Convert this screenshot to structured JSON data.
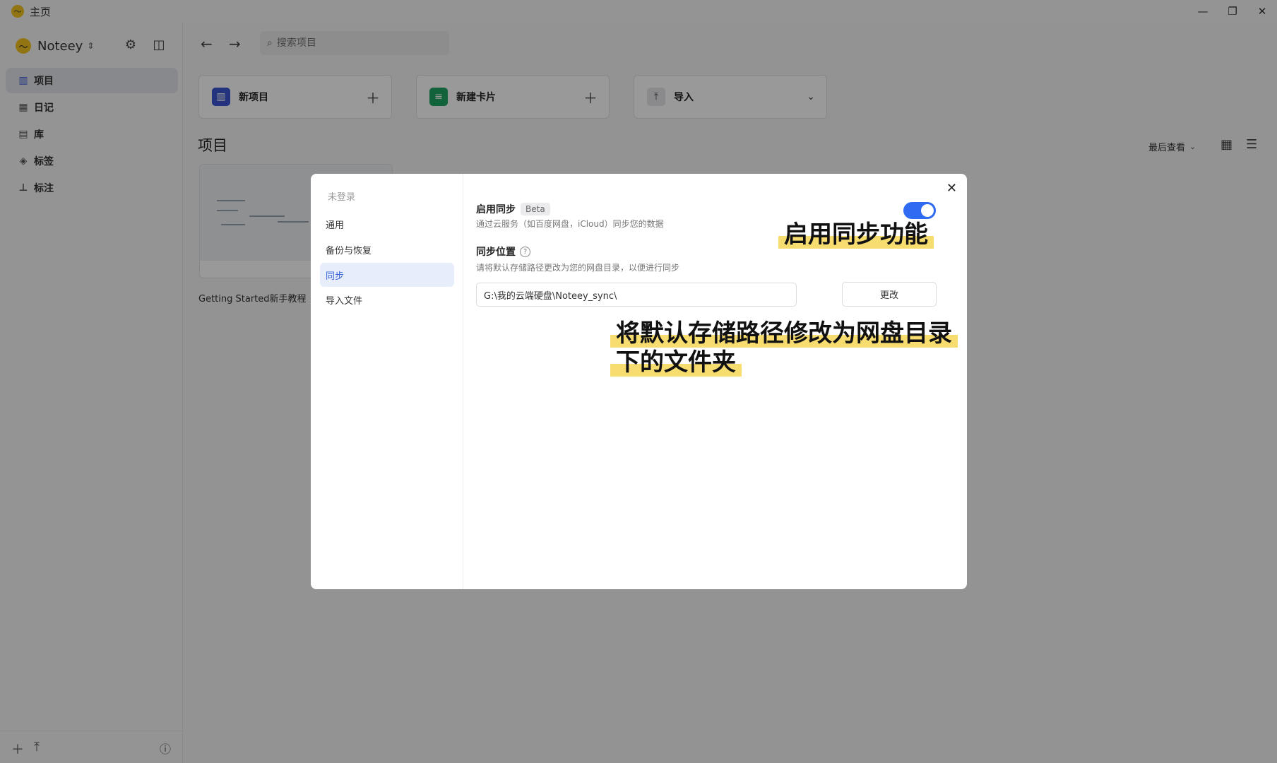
{
  "window": {
    "title": "主页",
    "controls": [
      "—",
      "❐",
      "✕"
    ]
  },
  "sidebar": {
    "workspace_name": "Noteey",
    "items": [
      {
        "label": "项目",
        "icon": "map-icon",
        "active": true
      },
      {
        "label": "日记",
        "icon": "calendar-icon",
        "active": false
      },
      {
        "label": "库",
        "icon": "library-icon",
        "active": false
      },
      {
        "label": "标签",
        "icon": "tag-icon",
        "active": false
      },
      {
        "label": "标注",
        "icon": "stamp-icon",
        "active": false
      }
    ]
  },
  "main": {
    "search_placeholder": "搜索项目",
    "actions": [
      {
        "label": "新项目",
        "icon": "map-icon",
        "color": "#3b56d1"
      },
      {
        "label": "新建卡片",
        "icon": "document-icon",
        "color": "#1fa463"
      },
      {
        "label": "导入",
        "icon": "upload-icon",
        "color": "#e6e7ea"
      }
    ],
    "section_title": "项目",
    "sort_label": "最后查看",
    "project": {
      "name": "Getting Started新手教程"
    }
  },
  "settings_modal": {
    "user_label": "未登录",
    "nav": [
      {
        "label": "通用",
        "active": false
      },
      {
        "label": "备份与恢复",
        "active": false
      },
      {
        "label": "同步",
        "active": true
      },
      {
        "label": "导入文件",
        "active": false
      }
    ],
    "sync": {
      "title": "启用同步",
      "badge": "Beta",
      "description": "通过云服务（如百度网盘，iCloud）同步您的数据",
      "enabled": true,
      "location_title": "同步位置",
      "location_description": "请将默认存储路径更改为您的网盘目录，以便进行同步",
      "path": "G:\\我的云端硬盘\\Noteey_sync\\",
      "change_label": "更改"
    }
  },
  "annotations": {
    "enable_sync": "启用同步功能",
    "change_path": "将默认存储路径修改为网盘目录下的文件夹"
  },
  "colors": {
    "accent": "#2f6bf2",
    "highlight": "#f7dc6f",
    "brand": "#f3c320"
  }
}
